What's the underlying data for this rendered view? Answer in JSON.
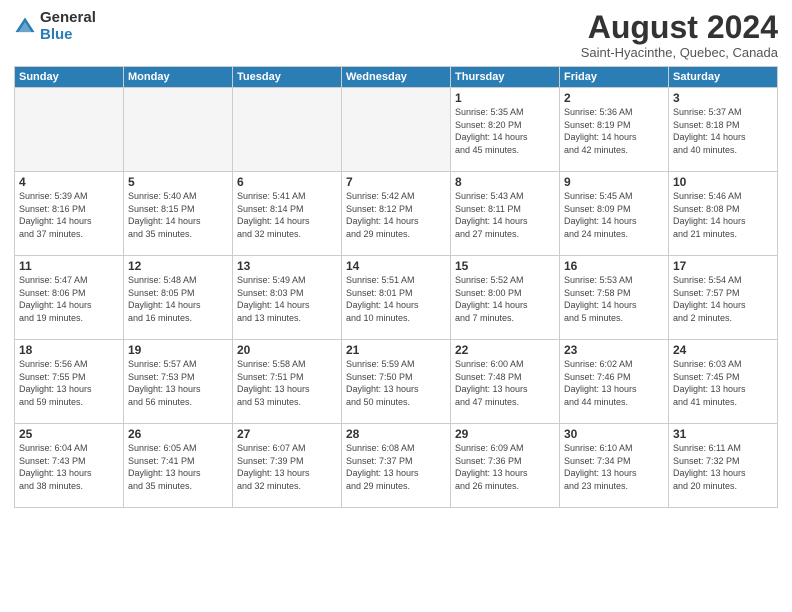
{
  "header": {
    "logo_general": "General",
    "logo_blue": "Blue",
    "month_year": "August 2024",
    "location": "Saint-Hyacinthe, Quebec, Canada"
  },
  "weekdays": [
    "Sunday",
    "Monday",
    "Tuesday",
    "Wednesday",
    "Thursday",
    "Friday",
    "Saturday"
  ],
  "weeks": [
    [
      {
        "day": "",
        "empty": true
      },
      {
        "day": "",
        "empty": true
      },
      {
        "day": "",
        "empty": true
      },
      {
        "day": "",
        "empty": true
      },
      {
        "day": "1",
        "line1": "Sunrise: 5:35 AM",
        "line2": "Sunset: 8:20 PM",
        "line3": "Daylight: 14 hours",
        "line4": "and 45 minutes."
      },
      {
        "day": "2",
        "line1": "Sunrise: 5:36 AM",
        "line2": "Sunset: 8:19 PM",
        "line3": "Daylight: 14 hours",
        "line4": "and 42 minutes."
      },
      {
        "day": "3",
        "line1": "Sunrise: 5:37 AM",
        "line2": "Sunset: 8:18 PM",
        "line3": "Daylight: 14 hours",
        "line4": "and 40 minutes."
      }
    ],
    [
      {
        "day": "4",
        "line1": "Sunrise: 5:39 AM",
        "line2": "Sunset: 8:16 PM",
        "line3": "Daylight: 14 hours",
        "line4": "and 37 minutes."
      },
      {
        "day": "5",
        "line1": "Sunrise: 5:40 AM",
        "line2": "Sunset: 8:15 PM",
        "line3": "Daylight: 14 hours",
        "line4": "and 35 minutes."
      },
      {
        "day": "6",
        "line1": "Sunrise: 5:41 AM",
        "line2": "Sunset: 8:14 PM",
        "line3": "Daylight: 14 hours",
        "line4": "and 32 minutes."
      },
      {
        "day": "7",
        "line1": "Sunrise: 5:42 AM",
        "line2": "Sunset: 8:12 PM",
        "line3": "Daylight: 14 hours",
        "line4": "and 29 minutes."
      },
      {
        "day": "8",
        "line1": "Sunrise: 5:43 AM",
        "line2": "Sunset: 8:11 PM",
        "line3": "Daylight: 14 hours",
        "line4": "and 27 minutes."
      },
      {
        "day": "9",
        "line1": "Sunrise: 5:45 AM",
        "line2": "Sunset: 8:09 PM",
        "line3": "Daylight: 14 hours",
        "line4": "and 24 minutes."
      },
      {
        "day": "10",
        "line1": "Sunrise: 5:46 AM",
        "line2": "Sunset: 8:08 PM",
        "line3": "Daylight: 14 hours",
        "line4": "and 21 minutes."
      }
    ],
    [
      {
        "day": "11",
        "line1": "Sunrise: 5:47 AM",
        "line2": "Sunset: 8:06 PM",
        "line3": "Daylight: 14 hours",
        "line4": "and 19 minutes."
      },
      {
        "day": "12",
        "line1": "Sunrise: 5:48 AM",
        "line2": "Sunset: 8:05 PM",
        "line3": "Daylight: 14 hours",
        "line4": "and 16 minutes."
      },
      {
        "day": "13",
        "line1": "Sunrise: 5:49 AM",
        "line2": "Sunset: 8:03 PM",
        "line3": "Daylight: 14 hours",
        "line4": "and 13 minutes."
      },
      {
        "day": "14",
        "line1": "Sunrise: 5:51 AM",
        "line2": "Sunset: 8:01 PM",
        "line3": "Daylight: 14 hours",
        "line4": "and 10 minutes."
      },
      {
        "day": "15",
        "line1": "Sunrise: 5:52 AM",
        "line2": "Sunset: 8:00 PM",
        "line3": "Daylight: 14 hours",
        "line4": "and 7 minutes."
      },
      {
        "day": "16",
        "line1": "Sunrise: 5:53 AM",
        "line2": "Sunset: 7:58 PM",
        "line3": "Daylight: 14 hours",
        "line4": "and 5 minutes."
      },
      {
        "day": "17",
        "line1": "Sunrise: 5:54 AM",
        "line2": "Sunset: 7:57 PM",
        "line3": "Daylight: 14 hours",
        "line4": "and 2 minutes."
      }
    ],
    [
      {
        "day": "18",
        "line1": "Sunrise: 5:56 AM",
        "line2": "Sunset: 7:55 PM",
        "line3": "Daylight: 13 hours",
        "line4": "and 59 minutes."
      },
      {
        "day": "19",
        "line1": "Sunrise: 5:57 AM",
        "line2": "Sunset: 7:53 PM",
        "line3": "Daylight: 13 hours",
        "line4": "and 56 minutes."
      },
      {
        "day": "20",
        "line1": "Sunrise: 5:58 AM",
        "line2": "Sunset: 7:51 PM",
        "line3": "Daylight: 13 hours",
        "line4": "and 53 minutes."
      },
      {
        "day": "21",
        "line1": "Sunrise: 5:59 AM",
        "line2": "Sunset: 7:50 PM",
        "line3": "Daylight: 13 hours",
        "line4": "and 50 minutes."
      },
      {
        "day": "22",
        "line1": "Sunrise: 6:00 AM",
        "line2": "Sunset: 7:48 PM",
        "line3": "Daylight: 13 hours",
        "line4": "and 47 minutes."
      },
      {
        "day": "23",
        "line1": "Sunrise: 6:02 AM",
        "line2": "Sunset: 7:46 PM",
        "line3": "Daylight: 13 hours",
        "line4": "and 44 minutes."
      },
      {
        "day": "24",
        "line1": "Sunrise: 6:03 AM",
        "line2": "Sunset: 7:45 PM",
        "line3": "Daylight: 13 hours",
        "line4": "and 41 minutes."
      }
    ],
    [
      {
        "day": "25",
        "line1": "Sunrise: 6:04 AM",
        "line2": "Sunset: 7:43 PM",
        "line3": "Daylight: 13 hours",
        "line4": "and 38 minutes."
      },
      {
        "day": "26",
        "line1": "Sunrise: 6:05 AM",
        "line2": "Sunset: 7:41 PM",
        "line3": "Daylight: 13 hours",
        "line4": "and 35 minutes."
      },
      {
        "day": "27",
        "line1": "Sunrise: 6:07 AM",
        "line2": "Sunset: 7:39 PM",
        "line3": "Daylight: 13 hours",
        "line4": "and 32 minutes."
      },
      {
        "day": "28",
        "line1": "Sunrise: 6:08 AM",
        "line2": "Sunset: 7:37 PM",
        "line3": "Daylight: 13 hours",
        "line4": "and 29 minutes."
      },
      {
        "day": "29",
        "line1": "Sunrise: 6:09 AM",
        "line2": "Sunset: 7:36 PM",
        "line3": "Daylight: 13 hours",
        "line4": "and 26 minutes."
      },
      {
        "day": "30",
        "line1": "Sunrise: 6:10 AM",
        "line2": "Sunset: 7:34 PM",
        "line3": "Daylight: 13 hours",
        "line4": "and 23 minutes."
      },
      {
        "day": "31",
        "line1": "Sunrise: 6:11 AM",
        "line2": "Sunset: 7:32 PM",
        "line3": "Daylight: 13 hours",
        "line4": "and 20 minutes."
      }
    ]
  ]
}
